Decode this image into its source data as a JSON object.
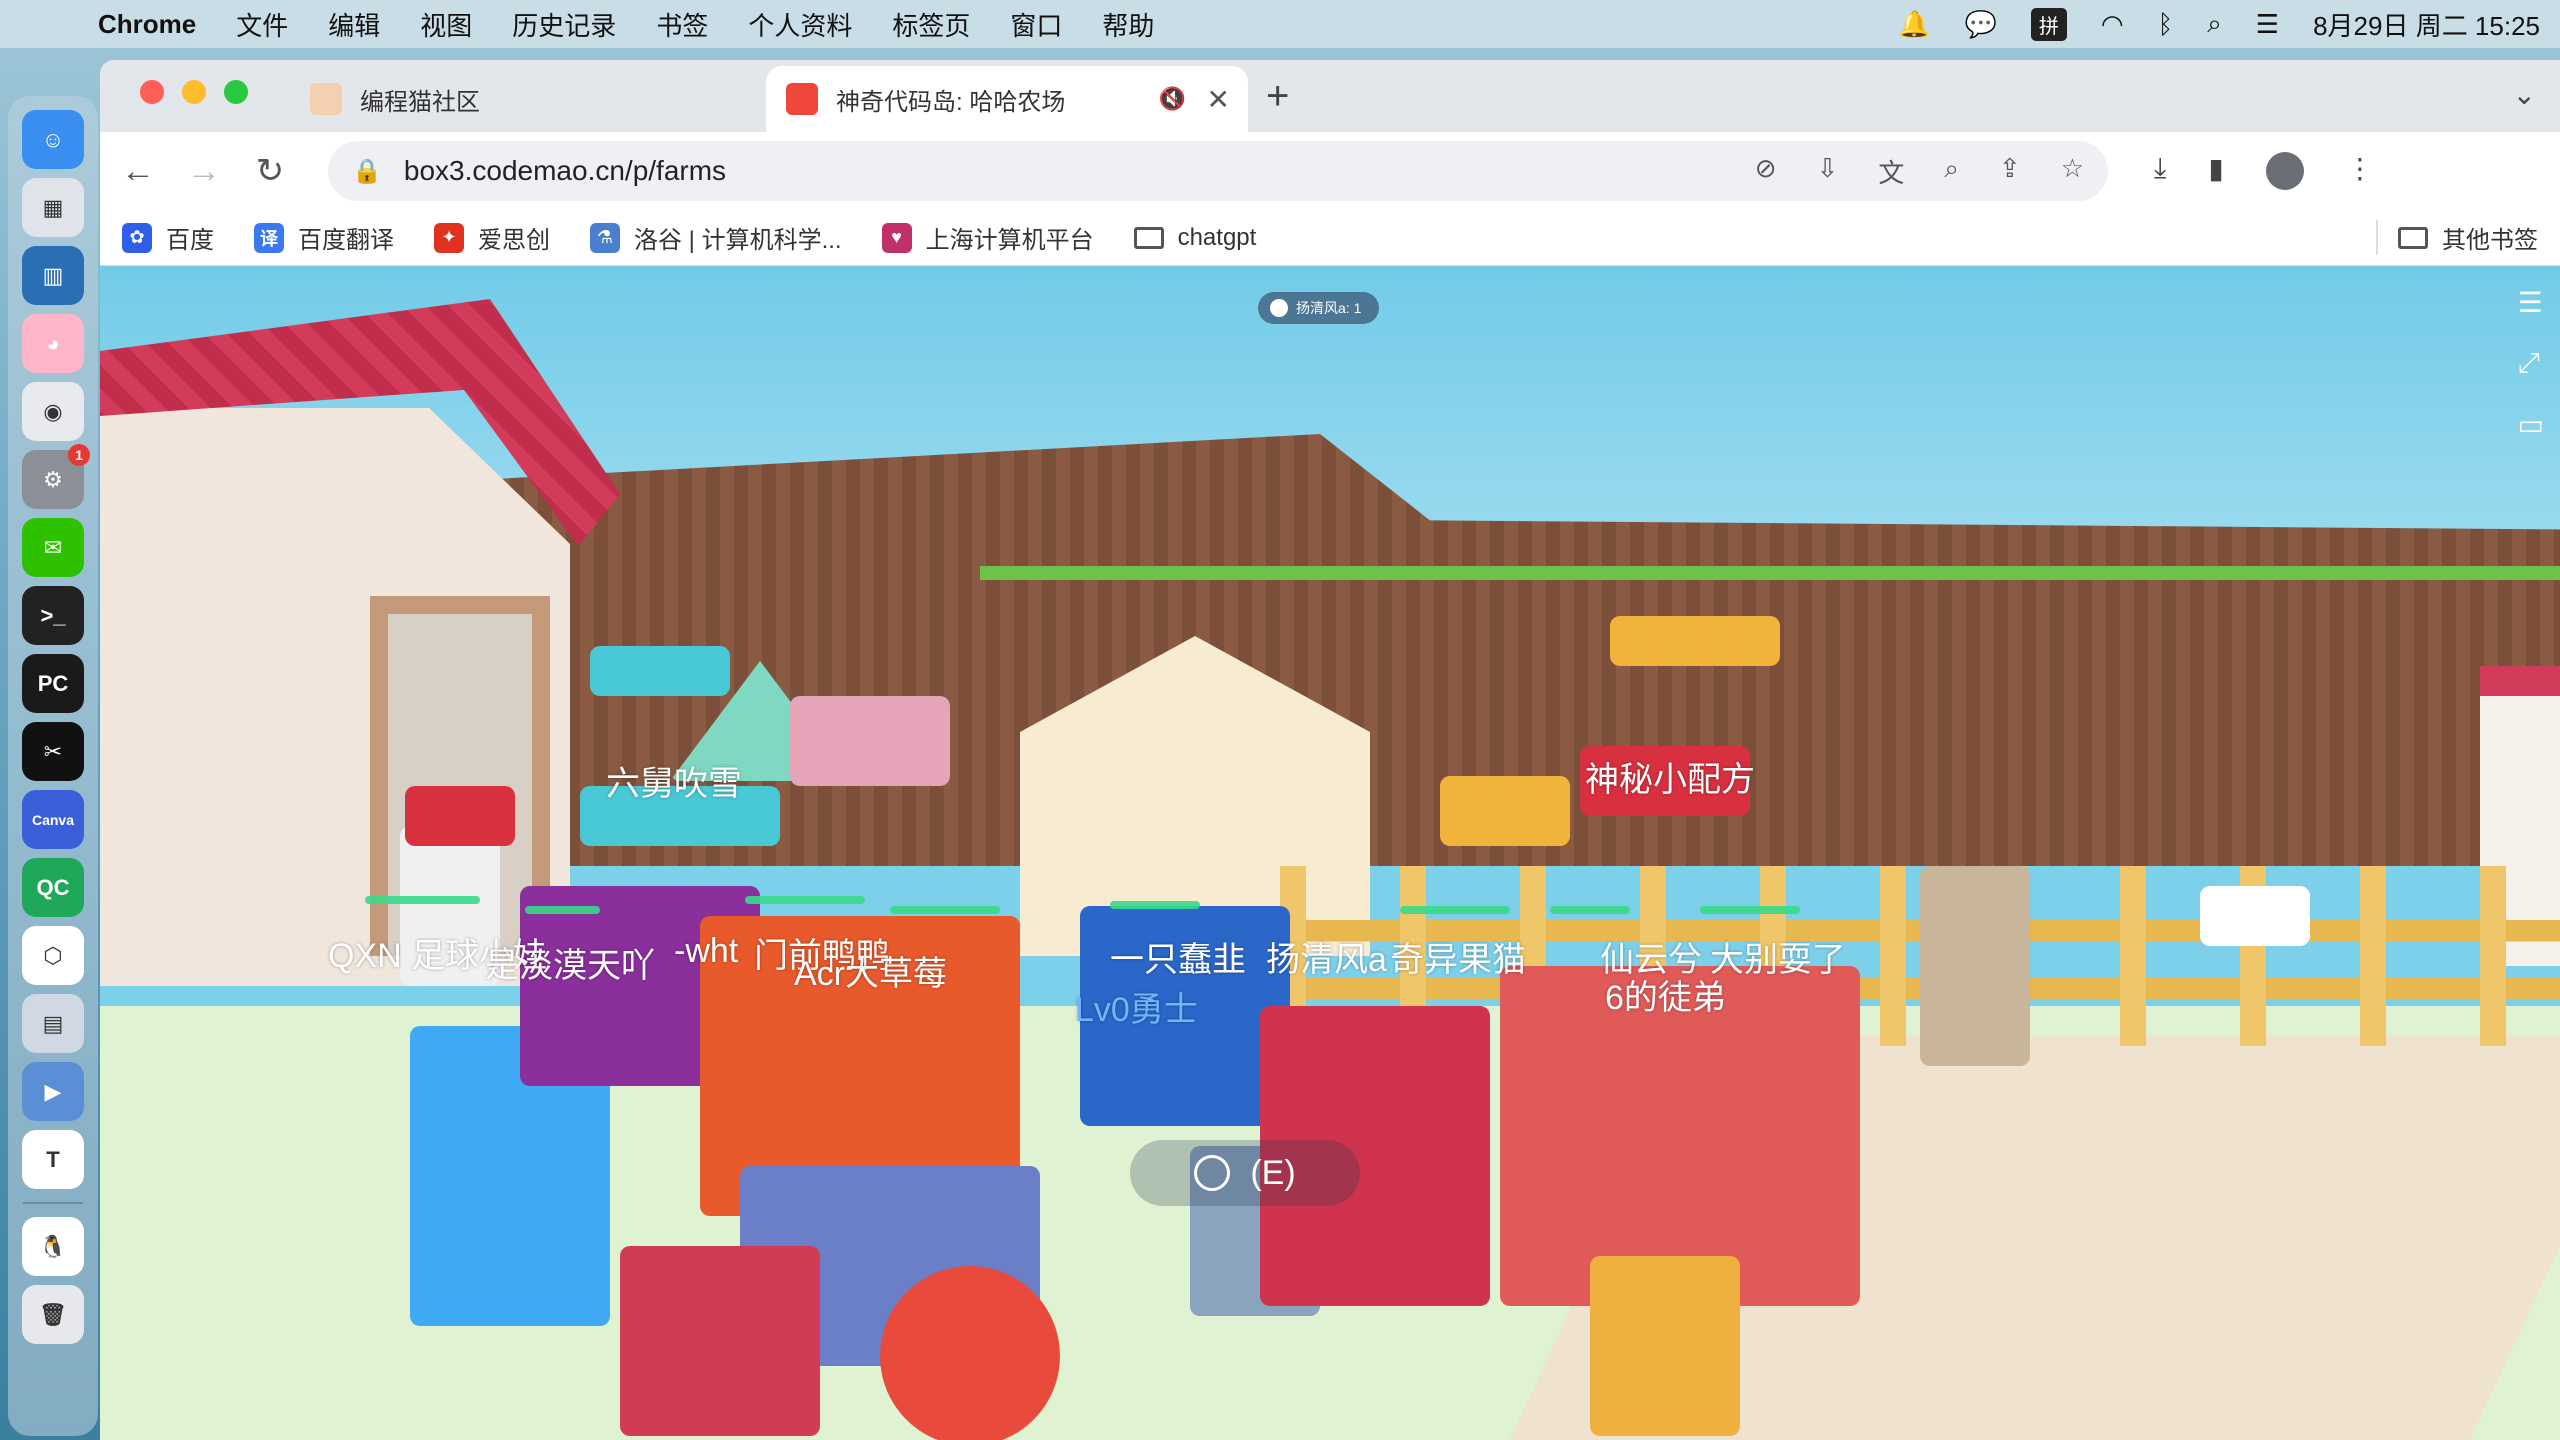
{
  "menubar": {
    "app_name": "Chrome",
    "items": [
      "文件",
      "编辑",
      "视图",
      "历史记录",
      "书签",
      "个人资料",
      "标签页",
      "窗口",
      "帮助"
    ],
    "ime_label": "拼",
    "datetime": "8月29日 周二  15:25"
  },
  "dock": {
    "apps": [
      {
        "name": "finder",
        "color": "#3a8ef0",
        "glyph": "☺"
      },
      {
        "name": "launchpad",
        "color": "#e0e4ea",
        "glyph": "▦"
      },
      {
        "name": "screen-monitor",
        "color": "#2a6fb3",
        "glyph": "▥"
      },
      {
        "name": "cartoon-app",
        "color": "#ffb6c8",
        "glyph": "◕"
      },
      {
        "name": "chrome",
        "color": "#e8eaee",
        "glyph": "◉"
      },
      {
        "name": "system-settings",
        "color": "#8c8f95",
        "glyph": "⚙",
        "badge": "1"
      },
      {
        "name": "wechat",
        "color": "#2dc100",
        "glyph": "✉"
      },
      {
        "name": "terminal",
        "color": "#222",
        "glyph": ">_"
      },
      {
        "name": "pycharm",
        "color": "#1a1a1a",
        "glyph": "PC"
      },
      {
        "name": "capcut",
        "color": "#111",
        "glyph": "✂"
      },
      {
        "name": "canva",
        "color": "#3b5fd9",
        "glyph": "Canva"
      },
      {
        "name": "qc-app",
        "color": "#1fa85a",
        "glyph": "QC"
      },
      {
        "name": "hexagon-app",
        "color": "#fff",
        "glyph": "⬡"
      },
      {
        "name": "preview",
        "color": "#cfd8e3",
        "glyph": "▤"
      },
      {
        "name": "quicktime",
        "color": "#5a8fd6",
        "glyph": "▶"
      },
      {
        "name": "typora",
        "color": "#fff",
        "glyph": "T"
      },
      {
        "name": "qq",
        "color": "#fff",
        "glyph": "🐧"
      },
      {
        "name": "trash",
        "color": "#e6e8eb",
        "glyph": "🗑"
      }
    ]
  },
  "tabs": [
    {
      "title": "编程猫社区",
      "active": false,
      "favicon_color": "#f5d0b0"
    },
    {
      "title": "神奇代码岛: 哈哈农场",
      "active": true,
      "favicon_color": "#f0473b"
    }
  ],
  "toolbar": {
    "url": "box3.codemao.cn/p/farms"
  },
  "bookmarks": [
    {
      "label": "百度",
      "icon_color": "#2f5ee8",
      "glyph": "✿"
    },
    {
      "label": "百度翻译",
      "icon_color": "#3b79f3",
      "glyph": "译"
    },
    {
      "label": "爱思创",
      "icon_color": "#e0321f",
      "glyph": "✦"
    },
    {
      "label": "洛谷 | 计算机科学...",
      "icon_color": "#4a7fd0",
      "glyph": "⚗"
    },
    {
      "label": "上海计算机平台",
      "icon_color": "#c0306a",
      "glyph": "♥"
    },
    {
      "label": "chatgpt",
      "icon_color": "",
      "glyph": "folder"
    }
  ],
  "other_bookmarks": "其他书签",
  "game": {
    "notice": "扬清风a: 1",
    "interact": "(E)",
    "nametags": [
      {
        "text": "六舅吹雪",
        "blue": false
      },
      {
        "text": "神秘小配方",
        "blue": false
      },
      {
        "text": "QXN 足球小娃",
        "blue": false
      },
      {
        "text": "是淡漠天吖",
        "blue": false
      },
      {
        "text": "-wht",
        "blue": false
      },
      {
        "text": "门前鸭鸭",
        "blue": false
      },
      {
        "text": "Acr大草莓",
        "blue": false
      },
      {
        "text": "一只蠢韭",
        "blue": false
      },
      {
        "text": "扬清风a",
        "blue": false
      },
      {
        "text": "奇异果猫",
        "blue": false
      },
      {
        "text": "仙云兮",
        "blue": false
      },
      {
        "text": "大别耍了",
        "blue": false
      },
      {
        "text": "6的徒弟",
        "blue": false
      },
      {
        "text": "Lv0勇士",
        "blue": true
      }
    ]
  }
}
